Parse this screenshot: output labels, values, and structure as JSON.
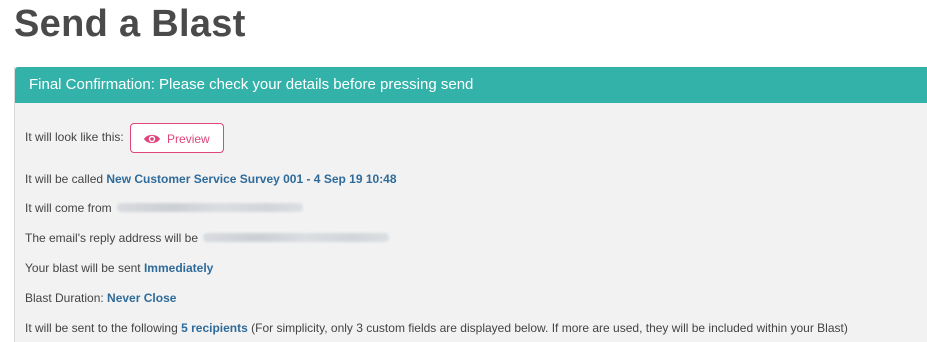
{
  "page": {
    "title": "Send a Blast"
  },
  "panel": {
    "header": "Final Confirmation: Please check your details before pressing send"
  },
  "rows": {
    "look_like": "It will look like this:",
    "preview_label": "Preview",
    "called_prefix": "It will be called ",
    "called_value": "New Customer Service Survey 001 - 4 Sep 19 10:48",
    "from_prefix": "It will come from",
    "reply_prefix": "The email's reply address will be",
    "sent_prefix": "Your blast will be sent ",
    "sent_value": "Immediately",
    "duration_prefix": "Blast Duration: ",
    "duration_value": "Never Close",
    "recipients_prefix": "It will be sent to the following ",
    "recipients_value": "5 recipients",
    "recipients_suffix": " (For simplicity, only 3 custom fields are displayed below. If more are used, they will be included within your Blast)"
  },
  "icons": {
    "preview": "eye-icon"
  },
  "colors": {
    "header_bg": "#33b2aa",
    "highlight": "#2f6b9a",
    "preview_accent": "#e0457b"
  }
}
